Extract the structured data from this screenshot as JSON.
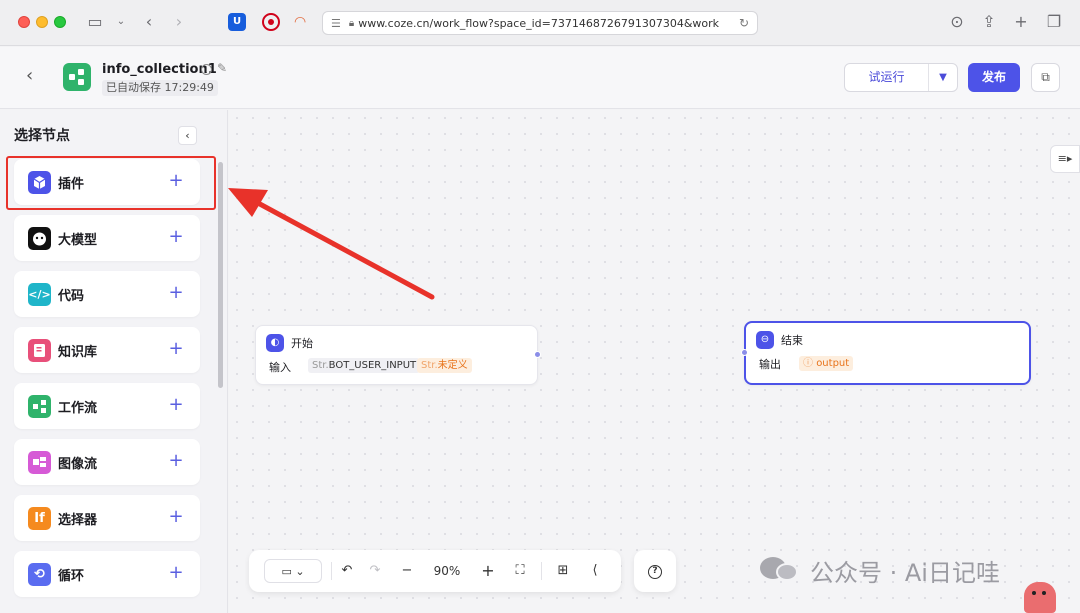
{
  "browser": {
    "url": "www.coze.cn/work_flow?space_id=7371468726791307304&work",
    "bitwarden_glyph": "U"
  },
  "header": {
    "title": "info_collection1",
    "autosave": "已自动保存 17:29:49",
    "run_label": "试运行",
    "publish_label": "发布"
  },
  "sidebar": {
    "title": "选择节点",
    "items": [
      {
        "label": "插件",
        "icon": "cube-icon",
        "color": "#4d53e8"
      },
      {
        "label": "大模型",
        "icon": "robot-face-icon",
        "color": "#111111"
      },
      {
        "label": "代码",
        "icon": "code-icon",
        "color": "#1fb5c9"
      },
      {
        "label": "知识库",
        "icon": "book-icon",
        "color": "#e8507a"
      },
      {
        "label": "工作流",
        "icon": "workflow-icon",
        "color": "#2fb36b"
      },
      {
        "label": "图像流",
        "icon": "image-flow-icon",
        "color": "#d65ad6"
      },
      {
        "label": "选择器",
        "icon": "if-icon",
        "color": "#f58a1f"
      },
      {
        "label": "循环",
        "icon": "loop-icon",
        "color": "#5a6cf0"
      }
    ]
  },
  "canvas": {
    "start_node": {
      "title": "开始",
      "row_label": "输入",
      "param_type": "Str.",
      "param_name": "BOT_USER_INPUT",
      "undefined_type": "Str.",
      "undefined_label": "未定义"
    },
    "end_node": {
      "title": "结束",
      "row_label": "输出",
      "output_tag": "output"
    }
  },
  "toolbar": {
    "zoom": "90%"
  },
  "watermark": {
    "text": "公众号 · Ai日记哇"
  },
  "colors": {
    "accent": "#4d53e8",
    "highlight": "#e8322a"
  }
}
